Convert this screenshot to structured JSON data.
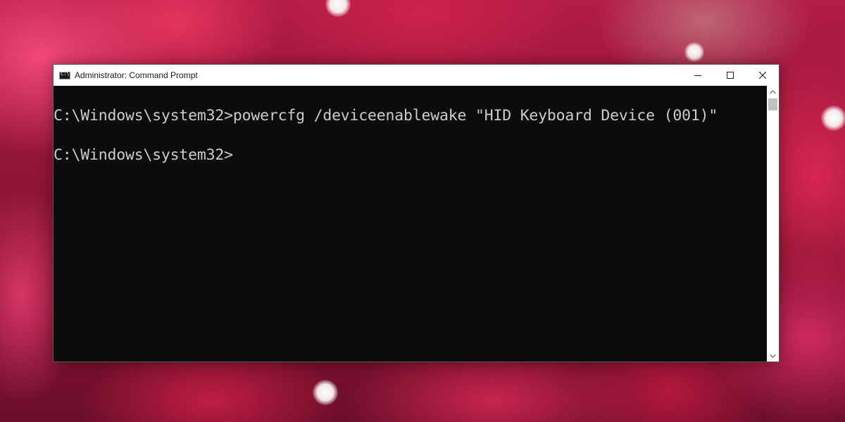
{
  "window": {
    "title": "Administrator: Command Prompt",
    "controls": {
      "minimize": "minimize-icon",
      "maximize": "maximize-icon",
      "close": "close-icon"
    }
  },
  "console": {
    "lines": [
      "C:\\Windows\\system32>powercfg /deviceenablewake \"HID Keyboard Device (001)\"",
      "C:\\Windows\\system32>"
    ]
  },
  "colors": {
    "console_bg": "#0c0c0c",
    "console_text": "#cccccc",
    "titlebar_bg": "#ffffff"
  }
}
